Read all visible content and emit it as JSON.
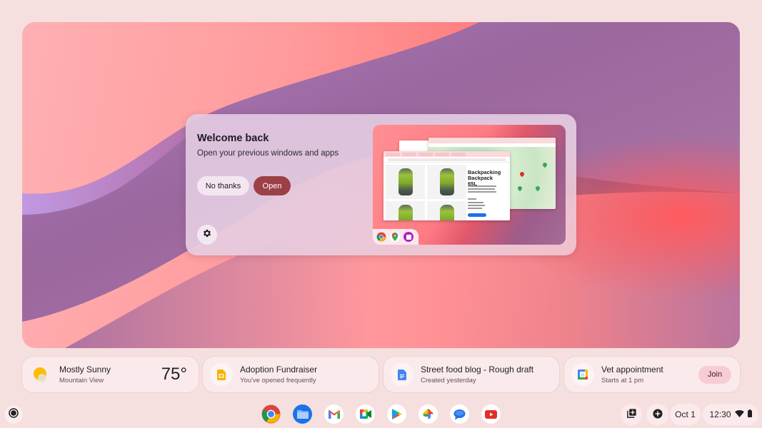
{
  "restore_dialog": {
    "title": "Welcome back",
    "subtitle": "Open your previous windows and apps",
    "no_thanks_label": "No thanks",
    "open_label": "Open",
    "settings_icon": "gear-icon",
    "preview": {
      "product_title": "Backpacking Backpack 65L",
      "app_icons": [
        "chrome-icon",
        "google-maps-icon",
        "app-icon"
      ]
    }
  },
  "suggestions": [
    {
      "icon": "weather-sunny-icon",
      "title": "Mostly Sunny",
      "subtitle": "Mountain View",
      "value": "75°"
    },
    {
      "icon": "google-slides-icon",
      "title": "Adoption Fundraiser",
      "subtitle": "You've opened frequently"
    },
    {
      "icon": "google-docs-icon",
      "title": "Street food blog - Rough draft",
      "subtitle": "Created yesterday"
    },
    {
      "icon": "google-calendar-icon",
      "title": "Vet appointment",
      "subtitle": "Starts at 1 pm",
      "action_label": "Join"
    }
  ],
  "shelf": {
    "launcher_icon": "launcher-icon",
    "apps": [
      "Chrome",
      "Files",
      "Gmail",
      "Google Meet",
      "Play Store",
      "Google Photos",
      "Messages",
      "YouTube"
    ]
  },
  "tray": {
    "tote_icon": "holding-space-icon",
    "add_icon": "plus-circle-icon",
    "date": "Oct 1",
    "time": "12:30",
    "wifi_icon": "wifi-icon",
    "battery_icon": "battery-icon"
  },
  "colors": {
    "accent": "#9c3f46",
    "background": "#f5dfdf",
    "chip": "#fbeaec",
    "join": "#f8ccd4"
  }
}
